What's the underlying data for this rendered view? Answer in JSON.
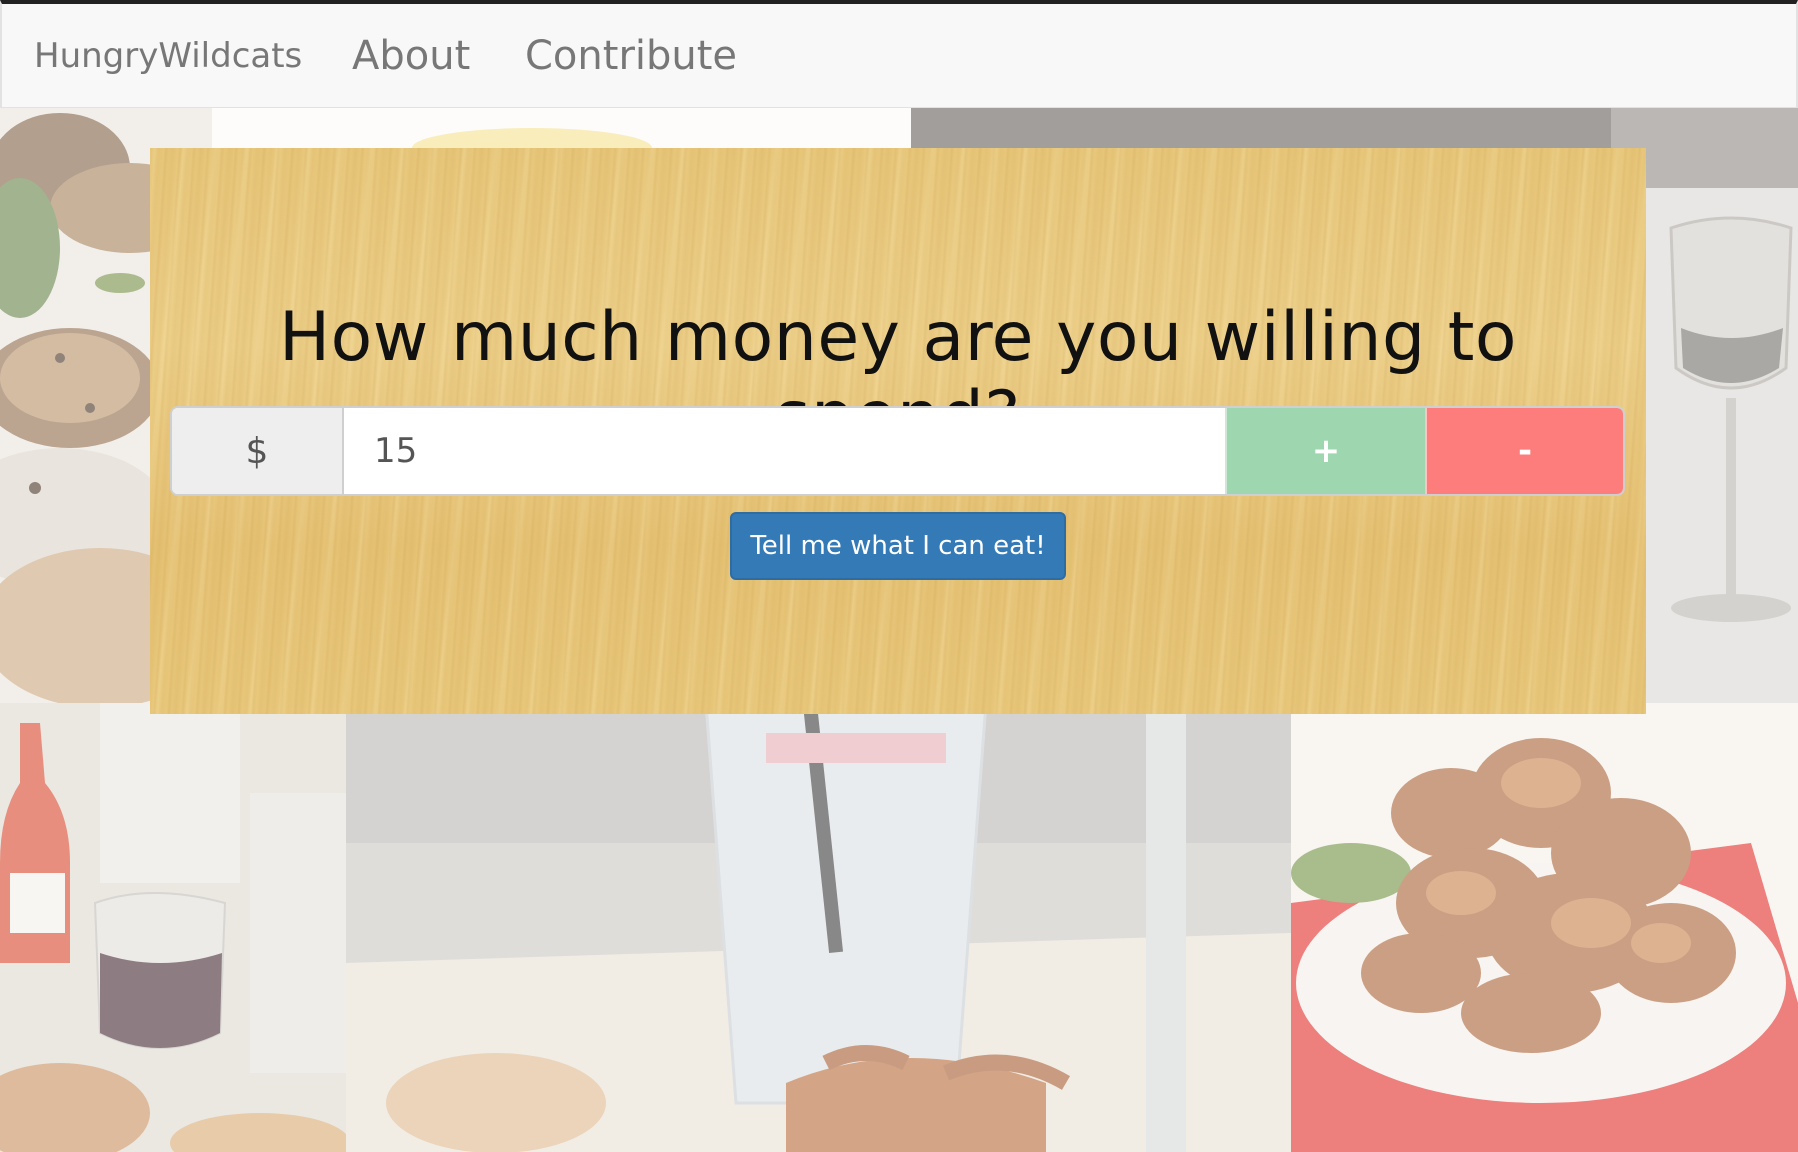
{
  "navbar": {
    "brand": "HungryWildcats",
    "links": [
      {
        "label": "About"
      },
      {
        "label": "Contribute"
      }
    ]
  },
  "hero": {
    "title": "How much money are you willing to spend?",
    "currency_symbol": "$",
    "amount_value": "15",
    "increment_label": "+",
    "decrement_label": "-",
    "submit_label": "Tell me what I can eat!"
  },
  "background": {
    "photos": [
      "bread-and-salad-photo",
      "lemon-dish-photo",
      "dark-table-photo",
      "wine-glass-photo",
      "hot-sauce-and-wine-photo",
      "lemonade-and-fries-photo",
      "fried-chicken-photo"
    ]
  },
  "colors": {
    "navbar_bg": "#f8f8f8",
    "plus_button": "#9ed6b0",
    "minus_button": "#fc7d7b",
    "primary_button": "#337ab7",
    "wood": "#e9c97d"
  }
}
